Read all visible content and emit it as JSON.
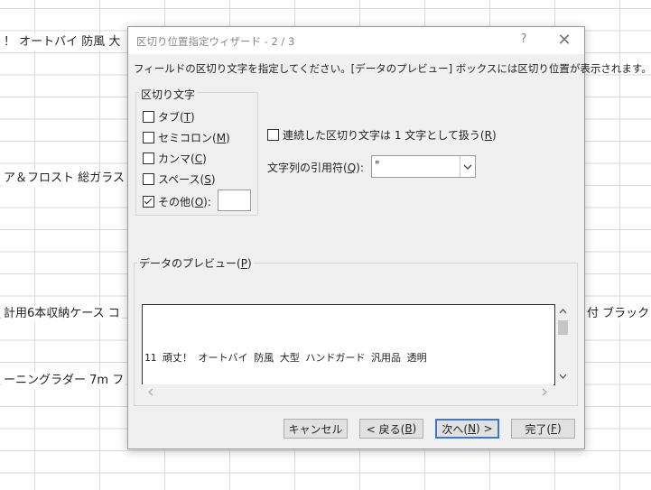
{
  "sheet": {
    "cells": [
      "！ オートバイ 防風 大",
      "ア＆フロスト 総ガラス",
      "計用6本収納ケース コ",
      "付 ブラック",
      "ーニングラダー 7m フ"
    ]
  },
  "dialog": {
    "title": "区切り位置指定ウィザード - 2 / 3",
    "help_label": "?",
    "close_label": "✕",
    "instruction": "フィールドの区切り文字を指定してください。[データのプレビュー] ボックスには区切り位置が表示されます。",
    "delimiters": {
      "legend": "区切り文字",
      "tab": {
        "text": "タブ(",
        "key": "T",
        "end": ")",
        "checked": false
      },
      "semicolon": {
        "text": "セミコロン(",
        "key": "M",
        "end": ")",
        "checked": false
      },
      "comma": {
        "text": "カンマ(",
        "key": "C",
        "end": ")",
        "checked": false
      },
      "space": {
        "text": "スペース(",
        "key": "S",
        "end": ")",
        "checked": false
      },
      "other": {
        "text": "その他(",
        "key": "O",
        "end": "):",
        "checked": true,
        "value": ""
      }
    },
    "consecutive": {
      "text": "連続した区切り文字は 1 文字として扱う(",
      "key": "R",
      "end": ")",
      "checked": false
    },
    "text_qualifier": {
      "text": "文字列の引用符(",
      "key": "Q",
      "end": "):",
      "value": "\""
    },
    "preview": {
      "legend_text": "データのプレビュー(",
      "legend_key": "P",
      "legend_end": ")",
      "lines": [
        "11 頑丈！ オートバイ 防風 大型 ハンドガード 汎用品 透明"
      ]
    },
    "buttons": {
      "cancel": "キャンセル",
      "back_text": "< 戻る(",
      "back_key": "B",
      "back_end": ")",
      "next_text": "次へ(",
      "next_key": "N",
      "next_end": ") >",
      "finish_text": "完了(",
      "finish_key": "F",
      "finish_end": ")"
    }
  },
  "colors": {
    "dialog_bg": "#f0f0f0",
    "default_button_border": "#3a78d4"
  },
  "icons": [
    "help-icon",
    "close-icon",
    "chevron-down-icon",
    "scroll-up-arrow-icon",
    "scroll-down-arrow-icon",
    "scroll-left-arrow-icon",
    "scroll-right-arrow-icon",
    "checkmark-icon"
  ]
}
